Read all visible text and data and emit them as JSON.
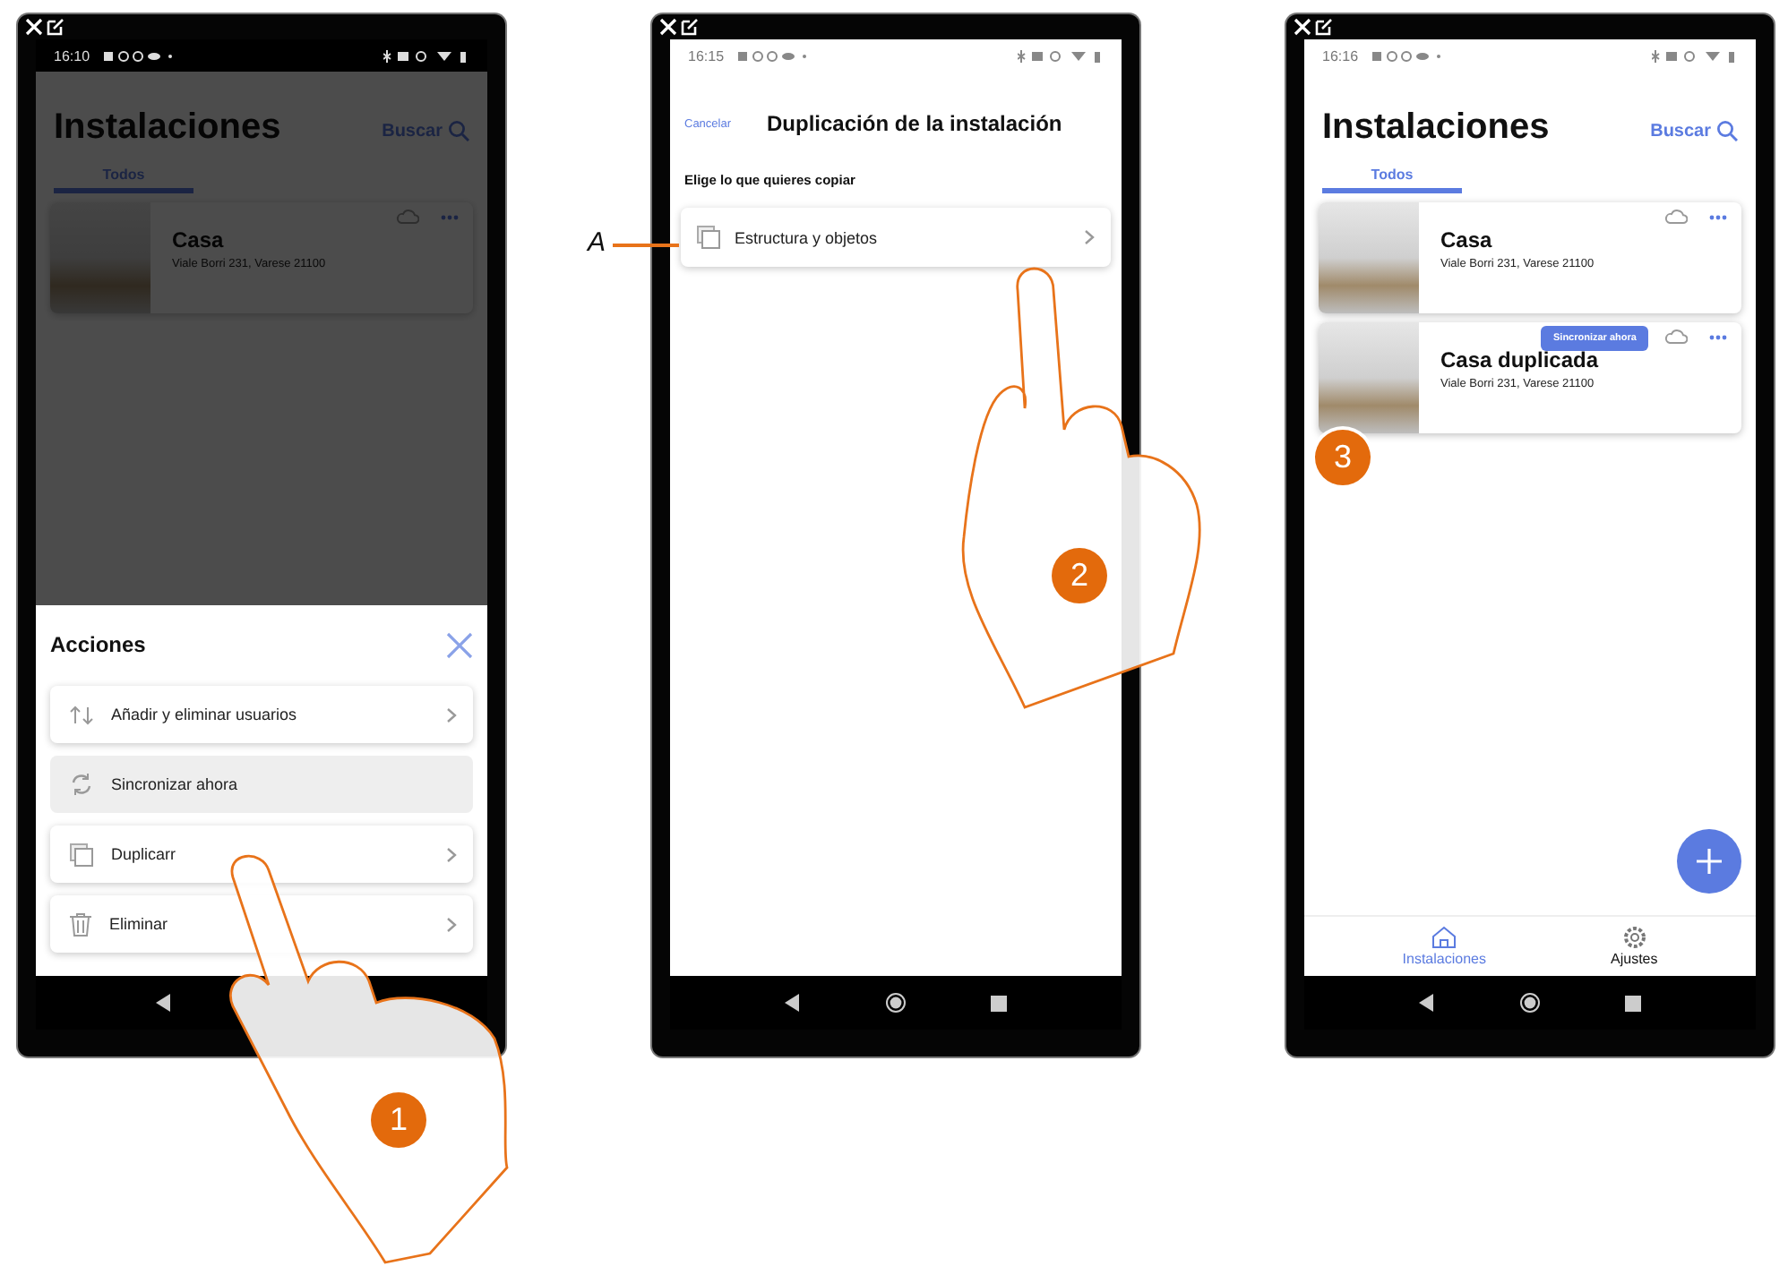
{
  "phones": [
    {
      "kind": "installations",
      "status_bar": {
        "time": "16:10",
        "dark": true
      },
      "title": "Instalaciones",
      "search": "Buscar",
      "tabs": [
        {
          "label": "Todos",
          "selected": true
        }
      ],
      "installations": [
        {
          "name": "Casa",
          "address": "Viale Borri 231, Varese 21100"
        }
      ],
      "sheet": {
        "title": "Acciones",
        "items": [
          {
            "label": "Añadir y eliminar usuarios",
            "kind": "users",
            "disabled": false
          },
          {
            "label": "Sincronizar ahora",
            "kind": "sync",
            "disabled": true
          },
          {
            "label": "Duplicarr",
            "kind": "copy",
            "disabled": false
          },
          {
            "label": "Eliminar",
            "kind": "trash",
            "disabled": false
          }
        ]
      },
      "step": "1"
    },
    {
      "kind": "duplicate",
      "status_bar": {
        "time": "16:15",
        "dark": false
      },
      "cancel": "Cancelar",
      "title": "Duplicación de la instalación",
      "subtitle": "Elige lo que quieres copiar",
      "options": [
        {
          "label": "Estructura y objetos",
          "callout": "A"
        }
      ],
      "step": "2"
    },
    {
      "kind": "installations",
      "status_bar": {
        "time": "16:16",
        "dark": false
      },
      "title": "Instalaciones",
      "search": "Buscar",
      "tabs": [
        {
          "label": "Todos",
          "selected": true
        }
      ],
      "installations": [
        {
          "name": "Casa",
          "address": "Viale Borri 231, Varese 21100"
        },
        {
          "name": "Casa duplicada",
          "address": "Viale Borri 231, Varese 21100",
          "tooltip": "Sincronizar ahora"
        }
      ],
      "bottom_nav": [
        {
          "label": "Instalaciones",
          "kind": "home",
          "selected": true
        },
        {
          "label": "Ajustes",
          "kind": "settings",
          "selected": false
        }
      ],
      "step": "3"
    }
  ]
}
